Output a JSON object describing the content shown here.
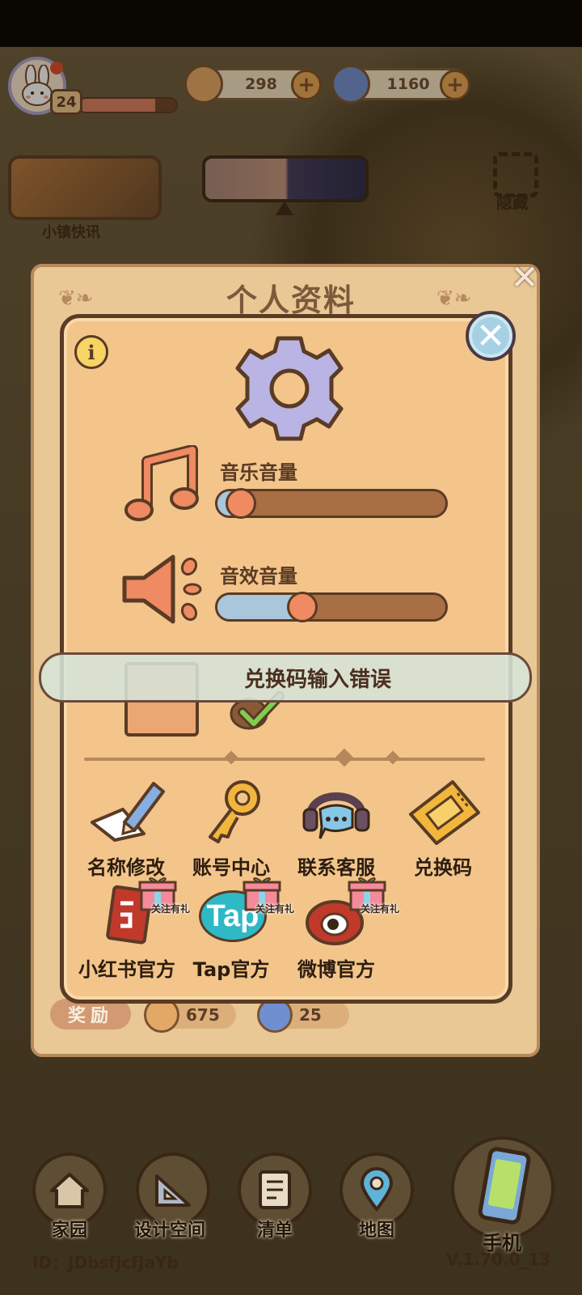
{
  "hud": {
    "level": "24",
    "xp_progress": 0.78,
    "coins": "298",
    "gems": "1160",
    "plus_symbol": "+"
  },
  "scene": {
    "news_label": "小镇快讯",
    "hide_label": "隐藏"
  },
  "profile_panel": {
    "title": "个人资料",
    "close_symbol": "✕",
    "reward_label": "奖励",
    "reward_coins": "675",
    "reward_gems": "25"
  },
  "settings": {
    "info_symbol": "i",
    "close_symbol": "✕",
    "music_label": "音乐音量",
    "music_level": 0.06,
    "sfx_label": "音效音量",
    "sfx_level": 0.33
  },
  "toast": {
    "message": "兑换码输入错误"
  },
  "options": [
    {
      "label": "名称修改",
      "icon": "pencil-icon"
    },
    {
      "label": "账号中心",
      "icon": "key-icon"
    },
    {
      "label": "联系客服",
      "icon": "headset-icon"
    },
    {
      "label": "兑换码",
      "icon": "ticket-icon"
    }
  ],
  "socials": [
    {
      "label": "小红书官方",
      "gift_text": "关注有礼"
    },
    {
      "label": "Tap官方",
      "gift_text": "关注有礼",
      "logo_text": "Tap"
    },
    {
      "label": "微博官方",
      "gift_text": "关注有礼"
    }
  ],
  "bottom_nav": {
    "home": "家园",
    "design": "设计空间",
    "list": "清单",
    "map": "地图",
    "phone": "手机"
  },
  "footer": {
    "player_id": "ID：JDbsfJcfJaYb",
    "version": "V.1.70.0_13"
  },
  "colors": {
    "dialog_bg": "#f3c58b",
    "border_brown": "#5a3b24",
    "slider_fill_blue": "#a9c6da",
    "knob_orange": "#ef8a62"
  }
}
